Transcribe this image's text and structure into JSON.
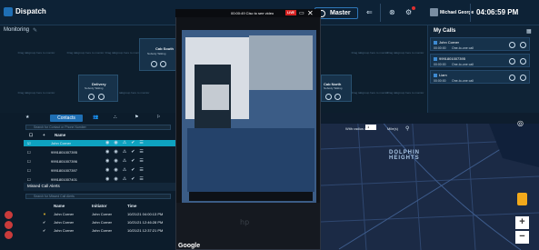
{
  "header": {
    "app_title": "Dispatch",
    "video_title": "00:00:49 Cisc to see video",
    "live_label": "LIVE",
    "master_label": "Master",
    "user_name": "Michael George",
    "clock": "04:06:59 PM",
    "brand_color": "#1f6fb4"
  },
  "monitoring": {
    "label": "Monitoring",
    "slot_text": "Drag talkgroup here to monitor",
    "cards": [
      {
        "name": "Cab South",
        "status": "Nobody Talking"
      },
      {
        "name": "Delivery",
        "status": "Nobody Talking"
      },
      {
        "name": "Cab North",
        "status": "Nobody Talking"
      }
    ]
  },
  "my_calls": {
    "title": "My Calls",
    "calls": [
      {
        "name": "John Corner",
        "time": "00:00:00",
        "status": "One-to-one call"
      },
      {
        "name": "9991801007395",
        "time": "00:00:00",
        "status": "One-to-one call"
      },
      {
        "name": "Liam",
        "time": "00:00:00",
        "status": "One-to-one call"
      }
    ]
  },
  "contacts": {
    "tab_label": "Contacts",
    "search_placeholder": "Search for Contact or Phone Number",
    "name_header": "Name",
    "rows": [
      {
        "name": "John Corner"
      },
      {
        "name": "9991801007395"
      },
      {
        "name": "9991801007396"
      },
      {
        "name": "9991801007397"
      },
      {
        "name": "9991801007401"
      }
    ]
  },
  "missed": {
    "title": "Missed Call Alerts",
    "search_placeholder": "Search for Missed Call Alerts",
    "headers": {
      "name": "Name",
      "initiator": "Initiator",
      "time": "Time"
    },
    "rows": [
      {
        "name": "John Corner",
        "initiator": "John Corner",
        "time": "10/21/21 04:00:13 PM"
      },
      {
        "name": "John Corner",
        "initiator": "John Corner",
        "time": "10/21/21 12:46:28 PM"
      },
      {
        "name": "John Corner",
        "initiator": "John Corner",
        "time": "10/21/21 12:37:21 PM"
      }
    ]
  },
  "map": {
    "radius_label": "With radius of",
    "radius_value": "1",
    "unit": "Mile(s)",
    "area_label": "DOLPHIN HEIGHTS",
    "zoom_in": "+",
    "zoom_out": "−",
    "attribution": "Google"
  }
}
